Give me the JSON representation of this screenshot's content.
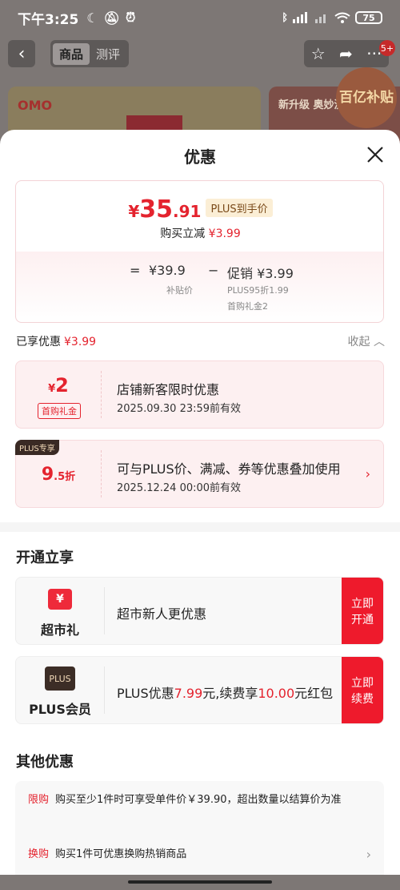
{
  "status": {
    "time": "下午3:25",
    "battery": "75"
  },
  "bg": {
    "tab_goods": "商品",
    "tab_review": "测评",
    "badge": "5+",
    "brand": "OMO",
    "banner_text": "新升级 奥妙洗",
    "seal": "百亿补贴"
  },
  "sheet": {
    "title": "优惠",
    "price": {
      "yen": "¥",
      "int": "35",
      "dec": ".91",
      "label": "PLUS到手价",
      "sub_text": "购买立减",
      "sub_amount": "¥3.99"
    },
    "calc": {
      "eq": "=",
      "subsidy_price": "¥39.9",
      "subsidy_label": "补贴价",
      "minus": "−",
      "promo": "促销 ¥3.99",
      "promo_detail1": "PLUS95折1.99",
      "promo_detail2": "首购礼金2"
    },
    "enjoyed_label": "已享优惠",
    "enjoyed_amount": "¥3.99",
    "collapse": "收起",
    "coupons": [
      {
        "yen": "¥",
        "amount": "2",
        "tag": "首购礼金",
        "title": "店铺新客限时优惠",
        "date": "2025.09.30 23:59前有效"
      },
      {
        "plus_tag": "PLUS专享",
        "amount_int": "9",
        "amount_dec": ".5折",
        "title": "可与PLUS价、满减、券等优惠叠加使用",
        "date": "2025.12.24 00:00前有效"
      }
    ],
    "open_section_title": "开通立享",
    "open_cards": [
      {
        "icon_text": "¥",
        "label": "超市礼",
        "desc": "超市新人更优惠",
        "btn": "立即开通"
      },
      {
        "icon_text": "PLUS",
        "label": "PLUS会员",
        "desc_a": "PLUS优惠",
        "desc_b": "7.99",
        "desc_c": "元,续费享",
        "desc_d": "10.00",
        "desc_e": "元红包",
        "btn": "立即续费"
      }
    ],
    "other_section_title": "其他优惠",
    "other": [
      {
        "tag": "限购",
        "text": "购买至少1件时可享受单件价￥39.90，超出数量以结算价为准"
      },
      {
        "tag": "换购",
        "text": "购买1件可优惠换购热销商品"
      }
    ],
    "accent_color": "#e4232e"
  }
}
